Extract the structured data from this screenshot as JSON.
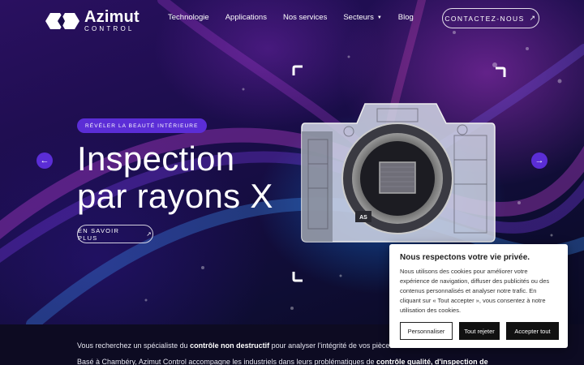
{
  "header": {
    "logo_name": "Azimut",
    "logo_sub": "CONTROL",
    "nav": [
      "Technologie",
      "Applications",
      "Nos services",
      "Secteurs",
      "Blog"
    ],
    "contact_label": "CONTACTEZ-NOUS"
  },
  "hero": {
    "badge": "RÉVÉLER LA BEAUTÉ INTÉRIEURE",
    "title_line1": "Inspection",
    "title_line2": "par rayons X",
    "cta": "EN SAVOIR PLUS"
  },
  "intro": {
    "line1_a": "Vous recherchez un spécialiste du ",
    "line1_b": "contrôle non destructif",
    "line1_c": " pour analyser l'intégrité de vos pièces",
    "line2_a": "Basé à Chambéry, Azimut Control accompagne les industriels dans leurs problématiques de ",
    "line2_b": "contrôle qualité, d'inspection de"
  },
  "cookie": {
    "title": "Nous respectons votre vie privée.",
    "text": "Nous utilisons des cookies pour améliorer votre expérience de navigation, diffuser des publicités ou des contenus personnalisés et analyser notre trafic. En cliquant sur « Tout accepter », vous consentez à notre utilisation des cookies.",
    "customize": "Personnaliser",
    "reject": "Tout rejeter",
    "accept": "Accepter tout"
  },
  "colors": {
    "accent": "#5b2dd6",
    "background": "#0c0a24"
  }
}
